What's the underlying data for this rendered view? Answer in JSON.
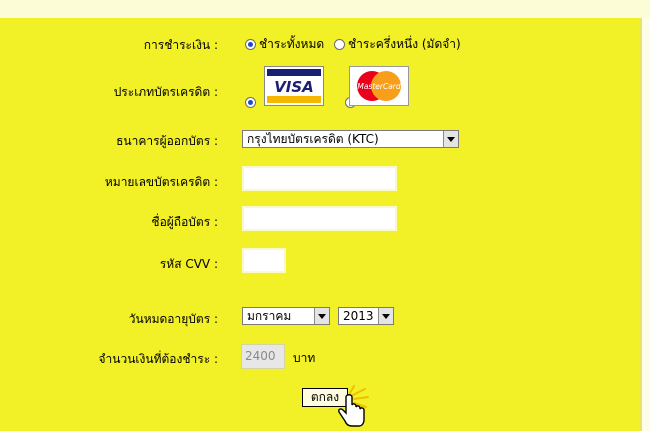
{
  "form": {
    "payment_label": "การชำระเงิน :",
    "payment_options": [
      "ชำระทั้งหมด",
      "ชำระครึ่งหนึ่ง (มัดจำ)"
    ],
    "card_type_label": "ประเภทบัตรเครดิต :",
    "card_types": [
      "VISA",
      "MasterCard"
    ],
    "bank_label": "ธนาคารผู้ออกบัตร :",
    "bank_selected": "กรุงไทยบัตรเครดิต (KTC)",
    "card_number_label": "หมายเลขบัตรเครดิต :",
    "card_number_value": "",
    "holder_name_label": "ชื่อผู้ถือบัตร :",
    "holder_name_value": "",
    "cvv_label": "รหัส CVV :",
    "cvv_value": "",
    "expiry_label": "วันหมดอายุบัตร :",
    "expiry_month": "มกราคม",
    "expiry_year": "2013",
    "amount_label": "จำนวนเงินที่ต้องชำระ :",
    "amount_value": "2400",
    "amount_unit": "บาท",
    "submit_label": "ตกลง"
  },
  "colors": {
    "panel": "#f2f027",
    "visa_blue": "#1a1f71",
    "visa_gold": "#f7b600",
    "mc_red": "#eb001b",
    "mc_orange": "#f79e1b"
  },
  "icons": [
    "hand-pointer-icon"
  ]
}
